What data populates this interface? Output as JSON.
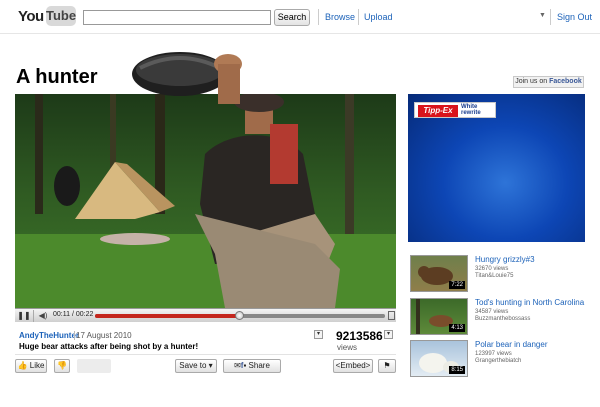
{
  "header": {
    "logo_you": "You",
    "logo_tube": "Tube",
    "search_value": "",
    "search_button": "Search",
    "browse": "Browse",
    "upload": "Upload",
    "sign_out": "Sign Out"
  },
  "video": {
    "title": "A hunter",
    "join_us": "Join us on ",
    "join_us_brand": "Facebook",
    "player": {
      "current_time": "00:11",
      "time_sep": " / ",
      "total_time": "00:22",
      "played_fraction": 0.5,
      "buffered_fraction": 1.0
    },
    "uploader": "AndyTheHunter",
    "date": "17 August 2010",
    "description": "Huge bear attacks after being shot by a hunter!",
    "views_count": "9213586",
    "views_label": "views"
  },
  "actions": {
    "like": "Like",
    "save_to": "Save to",
    "share": "Share",
    "embed": "<Embed>"
  },
  "ad": {
    "brand": "Tipp-Ex",
    "tagline_line1": "White",
    "tagline_line2": "rewrite",
    "brand_color": "#d9141b",
    "background": "#0d46b5"
  },
  "related": [
    {
      "title": "Hungry grizzly#3",
      "views": "32670 views",
      "author": "Titan&Louie75",
      "duration": "7:22"
    },
    {
      "title": "Tod's hunting in North Carolina",
      "views": "34587 views",
      "author": "Buzzmanthebossass",
      "duration": "4:13"
    },
    {
      "title": "Polar bear in danger",
      "views": "123997 views",
      "author": "Grangerthebiatch",
      "duration": "8:15"
    }
  ],
  "colors": {
    "link": "#1c62b9",
    "progress": "#c4261d"
  }
}
